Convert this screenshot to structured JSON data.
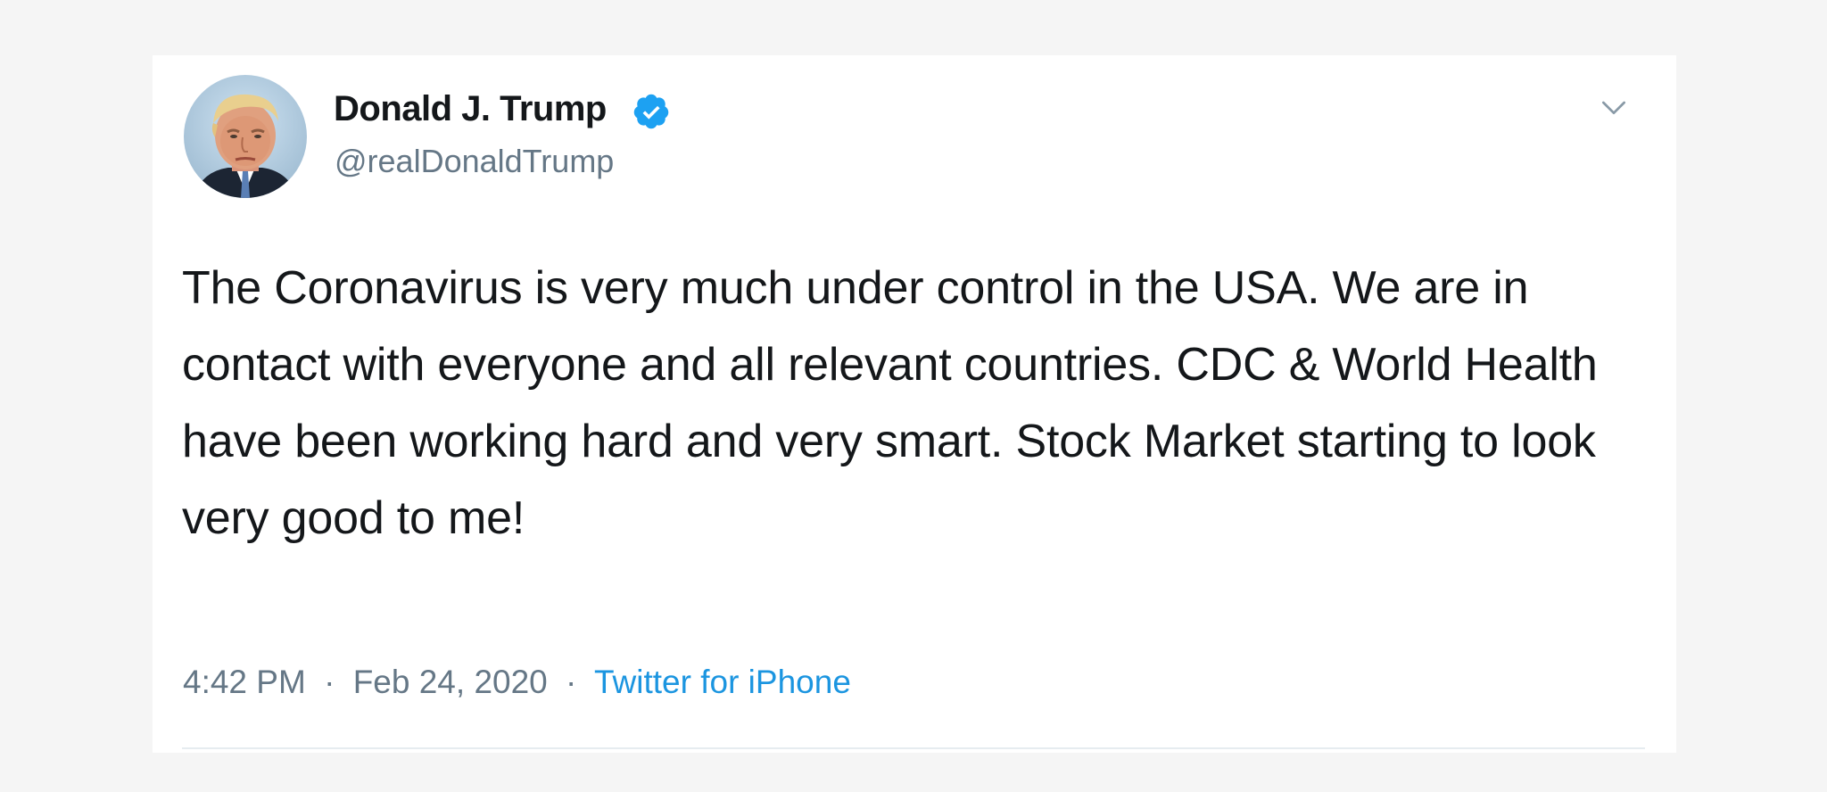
{
  "tweet": {
    "author": {
      "display_name": "Donald J. Trump",
      "handle": "@realDonaldTrump",
      "verified": true
    },
    "text": "The Coronavirus is very much under control in the USA. We are in contact with everyone and all relevant countries. CDC & World Health have been working hard and very smart. Stock Market starting to look very good to me!",
    "time": "4:42 PM",
    "date": "Feb 24, 2020",
    "separator": "·",
    "source": "Twitter for iPhone"
  },
  "colors": {
    "background": "#f5f5f5",
    "card": "#ffffff",
    "text_primary": "#14171a",
    "text_secondary": "#657786",
    "accent": "#1b95e0",
    "verified": "#1da1f2"
  },
  "icons": {
    "verified": "verified-badge-icon",
    "menu": "chevron-down-icon"
  }
}
